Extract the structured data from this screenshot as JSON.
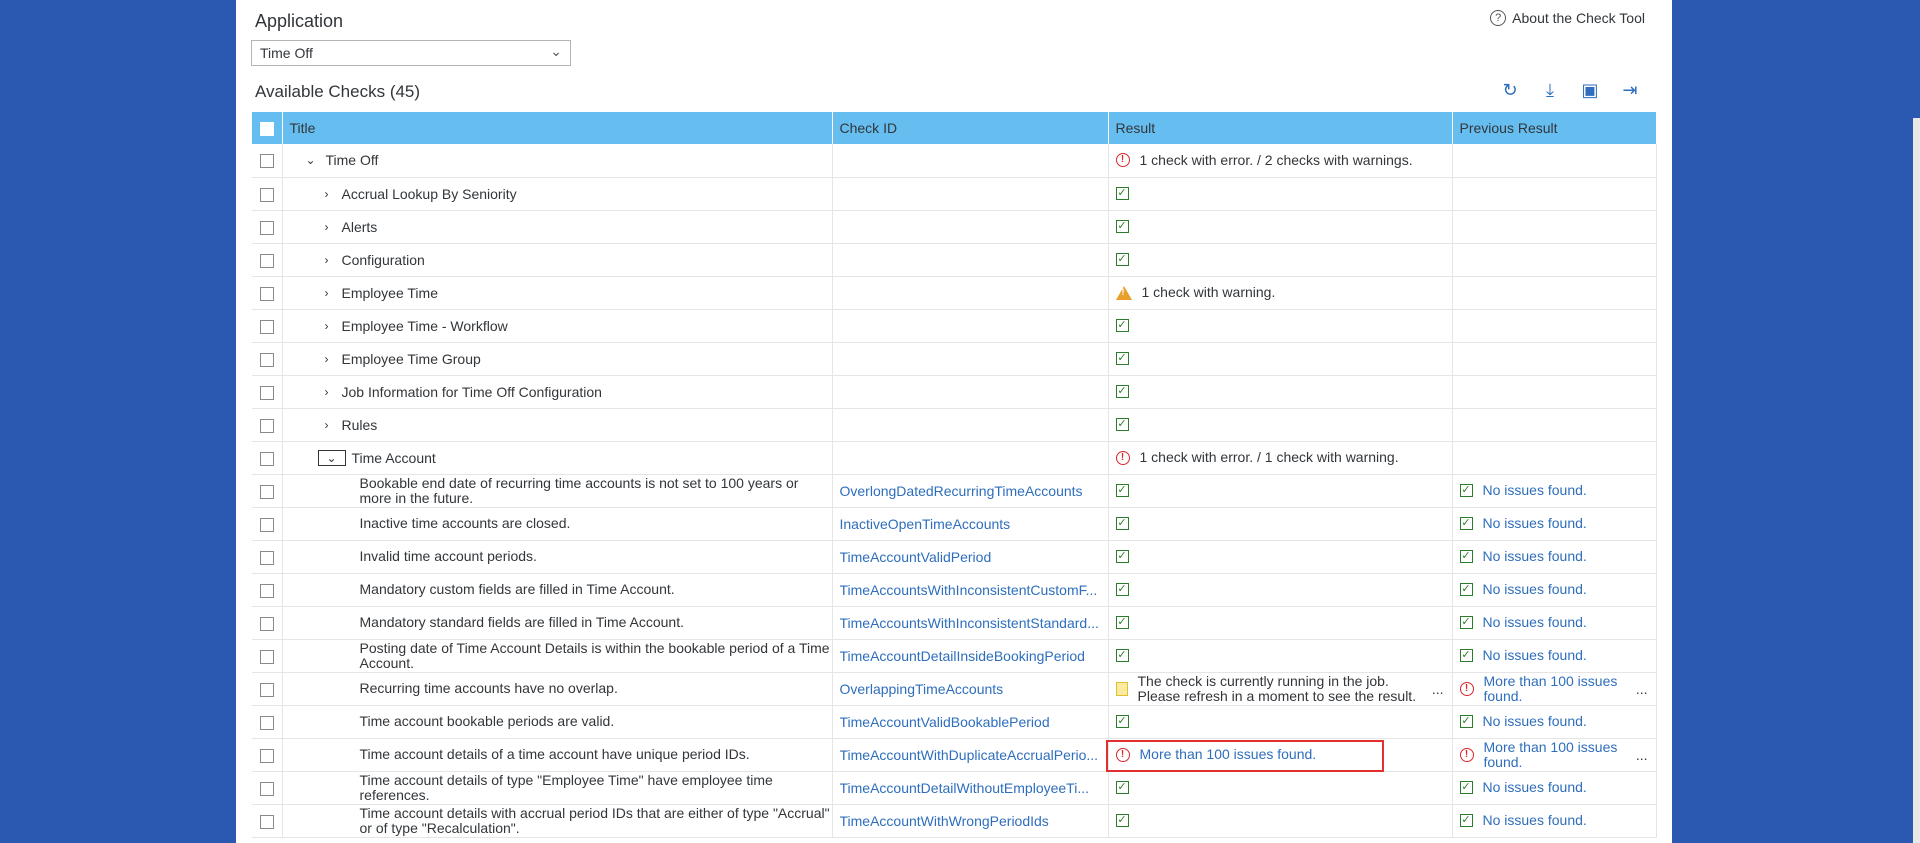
{
  "app": {
    "application_label": "Application",
    "application_value": "Time Off",
    "about_label": "About the Check Tool",
    "available_checks_label": "Available Checks (45)"
  },
  "toolbar": {
    "icons": [
      "refresh-icon",
      "download-icon",
      "export-icon",
      "sidebar-icon"
    ]
  },
  "table": {
    "columns": [
      "Title",
      "Check ID",
      "Result",
      "Previous Result"
    ],
    "rows": [
      {
        "title": "Time Off",
        "check_id": "",
        "result": "1 check with error. / 2 checks with warnings.",
        "result_status": "error",
        "prev": "",
        "prev_status": ""
      },
      {
        "title": "Accrual Lookup By Seniority",
        "check_id": "",
        "result": "",
        "result_status": "ok",
        "prev": "",
        "prev_status": ""
      },
      {
        "title": "Alerts",
        "check_id": "",
        "result": "",
        "result_status": "ok",
        "prev": "",
        "prev_status": ""
      },
      {
        "title": "Configuration",
        "check_id": "",
        "result": "",
        "result_status": "ok",
        "prev": "",
        "prev_status": ""
      },
      {
        "title": "Employee Time",
        "check_id": "",
        "result": "1 check with warning.",
        "result_status": "warning",
        "prev": "",
        "prev_status": ""
      },
      {
        "title": "Employee Time - Workflow",
        "check_id": "",
        "result": "",
        "result_status": "ok",
        "prev": "",
        "prev_status": ""
      },
      {
        "title": "Employee Time Group",
        "check_id": "",
        "result": "",
        "result_status": "ok",
        "prev": "",
        "prev_status": ""
      },
      {
        "title": "Job Information for Time Off Configuration",
        "check_id": "",
        "result": "",
        "result_status": "ok",
        "prev": "",
        "prev_status": ""
      },
      {
        "title": "Rules",
        "check_id": "",
        "result": "",
        "result_status": "ok",
        "prev": "",
        "prev_status": ""
      },
      {
        "title": "Time Account",
        "check_id": "",
        "result": "1 check with error. / 1 check with warning.",
        "result_status": "error",
        "prev": "",
        "prev_status": ""
      },
      {
        "title": "Bookable end date of recurring time accounts is not set to 100 years or more in the future.",
        "check_id": "OverlongDatedRecurringTimeAccounts",
        "result": "",
        "result_status": "ok",
        "prev": "No issues found.",
        "prev_status": "ok"
      },
      {
        "title": "Inactive time accounts are closed.",
        "check_id": "InactiveOpenTimeAccounts",
        "result": "",
        "result_status": "ok",
        "prev": "No issues found.",
        "prev_status": "ok"
      },
      {
        "title": "Invalid time account periods.",
        "check_id": "TimeAccountValidPeriod",
        "result": "",
        "result_status": "ok",
        "prev": "No issues found.",
        "prev_status": "ok"
      },
      {
        "title": "Mandatory custom fields are filled in Time Account.",
        "check_id": "TimeAccountsWithInconsistentCustomF...",
        "result": "",
        "result_status": "ok",
        "prev": "No issues found.",
        "prev_status": "ok"
      },
      {
        "title": "Mandatory standard fields are filled in Time Account.",
        "check_id": "TimeAccountsWithInconsistentStandard...",
        "result": "",
        "result_status": "ok",
        "prev": "No issues found.",
        "prev_status": "ok"
      },
      {
        "title": "Posting date of Time Account Details is within the bookable period of a Time Account.",
        "check_id": "TimeAccountDetailInsideBookingPeriod",
        "result": "",
        "result_status": "ok",
        "prev": "No issues found.",
        "prev_status": "ok"
      },
      {
        "title": "Recurring time accounts have no overlap.",
        "check_id": "OverlappingTimeAccounts",
        "result": "The check is currently running in the job. Please refresh in a moment to see the result.",
        "result_status": "running",
        "prev": "More than 100 issues found.",
        "prev_status": "error"
      },
      {
        "title": "Time account bookable periods are valid.",
        "check_id": "TimeAccountValidBookablePeriod",
        "result": "",
        "result_status": "ok",
        "prev": "No issues found.",
        "prev_status": "ok"
      },
      {
        "title": "Time account details of a time account have unique period IDs.",
        "check_id": "TimeAccountWithDuplicateAccrualPerio...",
        "result": "More than 100 issues found.",
        "result_status": "error",
        "prev": "More than 100 issues found.",
        "prev_status": "error"
      },
      {
        "title": "Time account details of type \"Employee Time\" have employee time references.",
        "check_id": "TimeAccountDetailWithoutEmployeeTi...",
        "result": "",
        "result_status": "ok",
        "prev": "No issues found.",
        "prev_status": "ok"
      },
      {
        "title": "Time account details with accrual period IDs that are either of type \"Accrual\" or of type \"Recalculation\".",
        "check_id": "TimeAccountWithWrongPeriodIds",
        "result": "",
        "result_status": "ok",
        "prev": "No issues found.",
        "prev_status": "ok"
      }
    ]
  },
  "more_label": "...",
  "colors": {
    "background": "#2b58b0",
    "header": "#66bdf0",
    "link": "#2e6ebd",
    "error": "#d9262c",
    "ok": "#2b7d2b",
    "warning": "#e9a02b",
    "highlight": "#e03030"
  }
}
